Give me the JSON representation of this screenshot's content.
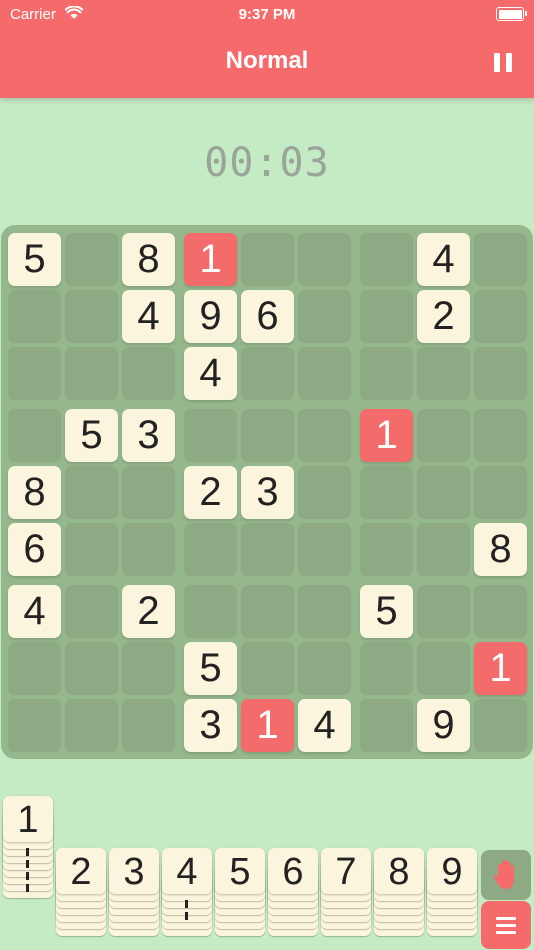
{
  "status_bar": {
    "carrier": "Carrier",
    "time": "9:37 PM"
  },
  "header": {
    "title": "Normal",
    "pause_icon": "pause-icon"
  },
  "timer": "00:03",
  "board": {
    "size": 9,
    "cells": [
      [
        "5",
        "",
        "8",
        "1",
        "",
        "",
        "",
        "4",
        ""
      ],
      [
        "",
        "",
        "4",
        "9",
        "6",
        "",
        "",
        "2",
        ""
      ],
      [
        "",
        "",
        "",
        "4",
        "",
        "",
        "",
        "",
        ""
      ],
      [
        "",
        "5",
        "3",
        "",
        "",
        "",
        "1",
        "",
        ""
      ],
      [
        "8",
        "",
        "",
        "2",
        "3",
        "",
        "",
        "",
        ""
      ],
      [
        "6",
        "",
        "",
        "",
        "",
        "",
        "",
        "",
        "8"
      ],
      [
        "4",
        "",
        "2",
        "",
        "",
        "",
        "5",
        "",
        ""
      ],
      [
        "",
        "",
        "",
        "5",
        "",
        "",
        "",
        "",
        "1"
      ],
      [
        "",
        "",
        "",
        "3",
        "1",
        "4",
        "",
        "9",
        ""
      ]
    ],
    "conflict_cells": [
      [
        0,
        3
      ],
      [
        3,
        6
      ],
      [
        7,
        8
      ],
      [
        8,
        4
      ]
    ],
    "colors": {
      "tile": "#fcf5dd",
      "conflict": "#f36b6b",
      "empty": "#8eaa84",
      "background": "#94b78c"
    }
  },
  "tray": {
    "digits": [
      "1",
      "2",
      "3",
      "4",
      "5",
      "6",
      "7",
      "8",
      "9"
    ],
    "tools": {
      "hand": "hand-icon",
      "menu": "menu-icon"
    }
  },
  "colors": {
    "accent": "#f56b6b",
    "background": "#c5ebc5"
  }
}
